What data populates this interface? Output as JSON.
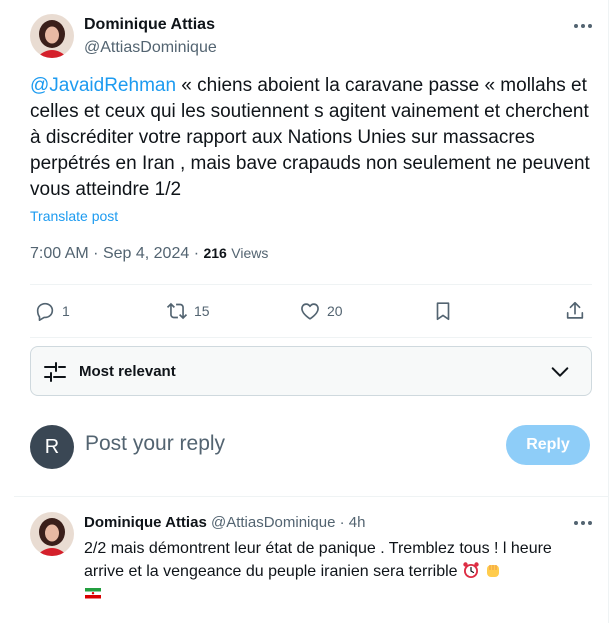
{
  "main_tweet": {
    "author_name": "Dominique Attias",
    "author_handle": "@AttiasDominique",
    "mention": "@JavaidRehman",
    "text": " « chiens aboient la caravane passe «  mollahs et celles et ceux qui les soutiennent s agitent vainement  et cherchent à discréditer votre  rapport aux Nations Unies sur massacres perpétrés en Iran , mais bave  crapauds non seulement ne peuvent vous atteindre 1/2",
    "translate_label": "Translate post",
    "time": "7:00 AM",
    "date": "Sep 4, 2024",
    "views_count": "216",
    "views_label": "Views",
    "separator": "·"
  },
  "actions": {
    "reply_count": "1",
    "repost_count": "15",
    "like_count": "20"
  },
  "sort": {
    "label": "Most relevant"
  },
  "composer": {
    "avatar_letter": "R",
    "placeholder": "Post your reply",
    "button_label": "Reply"
  },
  "reply_tweet": {
    "author_name": "Dominique Attias",
    "author_handle": "@AttiasDominique",
    "age": "4h",
    "text": "2/2 mais démontrent leur état de panique . Tremblez tous ! l heure arrive et la vengeance du peuple iranien sera terrible"
  },
  "icons": {
    "reply": "speech-bubble-icon",
    "repost": "repost-arrows-icon",
    "like": "heart-icon",
    "bookmark": "bookmark-icon",
    "share": "share-upload-icon",
    "sort": "sliders-icon",
    "chevron": "chevron-down-icon",
    "more": "more-dots-icon"
  },
  "colors": {
    "accent": "#1d9bf0",
    "muted": "#536471",
    "reply_button": "#8ecdf8"
  }
}
